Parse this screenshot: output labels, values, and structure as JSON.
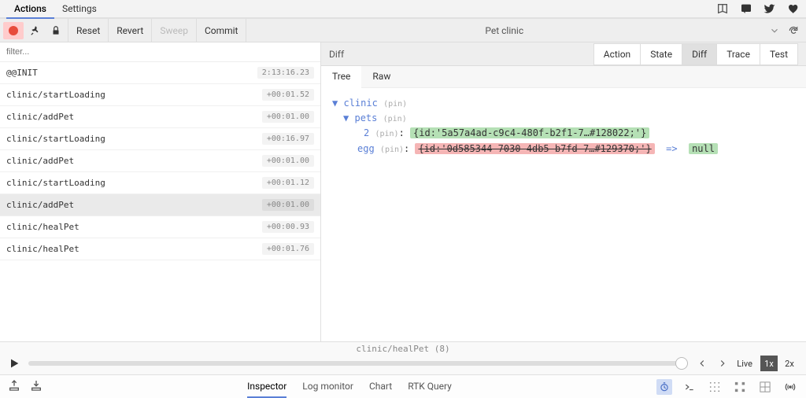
{
  "topbar": {
    "tabs": [
      "Actions",
      "Settings"
    ],
    "active": 0
  },
  "toolbar": {
    "commands": [
      {
        "label": "Reset",
        "disabled": false
      },
      {
        "label": "Revert",
        "disabled": false
      },
      {
        "label": "Sweep",
        "disabled": true
      },
      {
        "label": "Commit",
        "disabled": false
      }
    ],
    "title": "Pet clinic"
  },
  "filter": {
    "placeholder": "filter..."
  },
  "actions": [
    {
      "name": "@@INIT",
      "time": "2:13:16.23",
      "selected": false
    },
    {
      "name": "clinic/startLoading",
      "time": "+00:01.52",
      "selected": false
    },
    {
      "name": "clinic/addPet",
      "time": "+00:01.00",
      "selected": false
    },
    {
      "name": "clinic/startLoading",
      "time": "+00:16.97",
      "selected": false
    },
    {
      "name": "clinic/addPet",
      "time": "+00:01.00",
      "selected": false
    },
    {
      "name": "clinic/startLoading",
      "time": "+00:01.12",
      "selected": false
    },
    {
      "name": "clinic/addPet",
      "time": "+00:01.00",
      "selected": true
    },
    {
      "name": "clinic/healPet",
      "time": "+00:00.93",
      "selected": false
    },
    {
      "name": "clinic/healPet",
      "time": "+00:01.76",
      "selected": false
    }
  ],
  "right": {
    "title": "Diff",
    "tabs": [
      "Action",
      "State",
      "Diff",
      "Trace",
      "Test"
    ],
    "active": 2,
    "subtabs": [
      "Tree",
      "Raw"
    ],
    "subactive": 0
  },
  "tree": {
    "root": "clinic",
    "pin": "(pin)",
    "pets": "pets",
    "item2_key": "2",
    "item2_val": "{id:'5a57a4ad-c9c4-480f-b2f1-7…#128022;'}",
    "egg_key": "egg",
    "egg_old": "{id:'0d585344-7030-4db5-b7fd-7…#129370;'}",
    "egg_arrow": "=>",
    "egg_new": "null"
  },
  "slider": {
    "label": "clinic/healPet (8)",
    "live": "Live",
    "speeds": [
      "1x",
      "2x"
    ],
    "active_speed": 0
  },
  "bottom": {
    "tabs": [
      "Inspector",
      "Log monitor",
      "Chart",
      "RTK Query"
    ],
    "active": 0
  }
}
